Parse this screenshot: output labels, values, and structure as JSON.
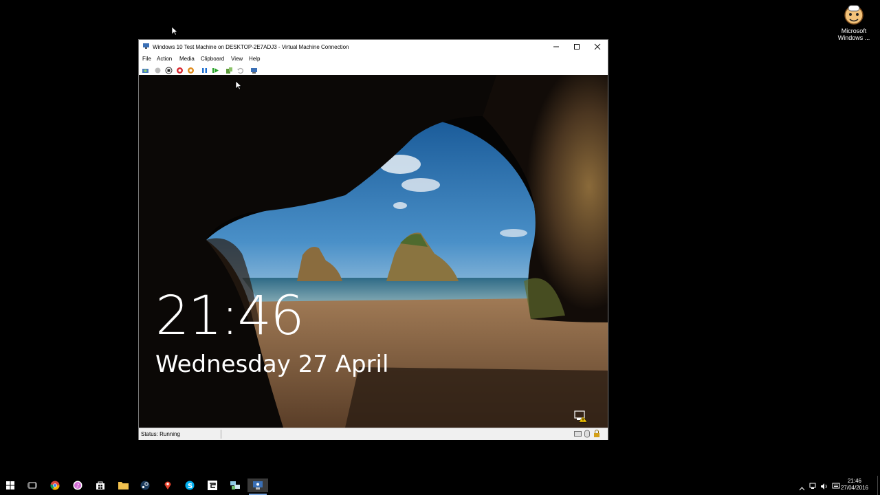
{
  "desktop": {
    "icon_label_line1": "Microsoft",
    "icon_label_line2": "Windows ..."
  },
  "vm_window": {
    "title": "Windows 10 Test Machine on DESKTOP-2E7ADJ3 - Virtual Machine Connection",
    "menu": [
      "File",
      "Action",
      "Media",
      "Clipboard",
      "View",
      "Help"
    ],
    "toolbar_icons": [
      "ctrl-alt-del-icon",
      "start-icon",
      "turn-off-icon",
      "shutdown-icon",
      "save-icon",
      "pause-icon",
      "reset-icon",
      "checkpoint-icon",
      "revert-icon",
      "enhanced-session-icon"
    ],
    "status": "Status: Running"
  },
  "lock_screen": {
    "time": "21:46",
    "date": "Wednesday 27 April"
  },
  "taskbar": {
    "clock_time": "21:46",
    "clock_date": "27/04/2016",
    "apps": [
      "start-icon",
      "task-view-icon",
      "chrome-icon",
      "itunes-icon",
      "store-icon",
      "file-explorer-icon",
      "steam-icon",
      "maps-icon",
      "skype-icon",
      "cortana-app-icon",
      "network-app-icon",
      "hyper-v-icon"
    ]
  },
  "colors": {
    "titlebar_bg": "#ffffff",
    "taskbar_bg": "#000000",
    "sky": "#2f78b8",
    "sand": "#9a7048"
  }
}
